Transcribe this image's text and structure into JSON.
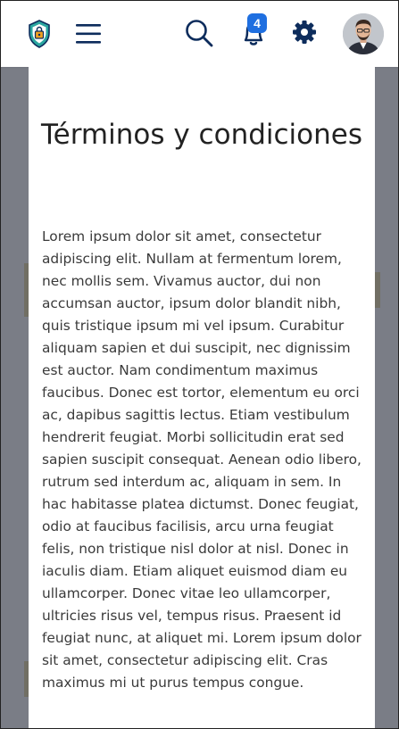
{
  "header": {
    "logo_icon": "shield-lock-icon",
    "menu_icon": "hamburger-menu-icon",
    "search_icon": "search-icon",
    "notifications_icon": "bell-icon",
    "notifications_count": "4",
    "settings_icon": "gear-icon",
    "avatar_icon": "user-avatar",
    "colors": {
      "icon": "#0d2c5c",
      "badge": "#1f6fe0",
      "logo_orange": "#f0a020",
      "logo_teal": "#2aa6a0"
    }
  },
  "modal": {
    "title": "Términos y condiciones",
    "body": "Lorem ipsum dolor sit amet, consectetur adipiscing elit. Nullam at fermentum lorem, nec mollis sem. Vivamus auctor, dui non accumsan auctor, ipsum dolor blandit nibh, quis tristique ipsum mi vel ipsum. Curabitur aliquam sapien et dui suscipit, nec dignissim est auctor. Nam condimentum maximus faucibus. Donec est tortor, elementum eu orci ac, dapibus sagittis lectus. Etiam vestibulum hendrerit feugiat. Morbi sollicitudin erat sed sapien suscipit consequat. Aenean odio libero, rutrum sed interdum ac, aliquam in sem. In hac habitasse platea dictumst. Donec feugiat, odio at faucibus facilisis, arcu urna feugiat felis, non tristique nisl dolor at nisl. Donec in iaculis diam. Etiam aliquet euismod diam eu ullamcorper. Donec vitae leo ullamcorper, ultricies risus vel, tempus risus. Praesent id feugiat nunc, at aliquet mi. Lorem ipsum dolor sit amet, consectetur adipiscing elit. Cras maximus mi ut purus tempus congue."
  }
}
